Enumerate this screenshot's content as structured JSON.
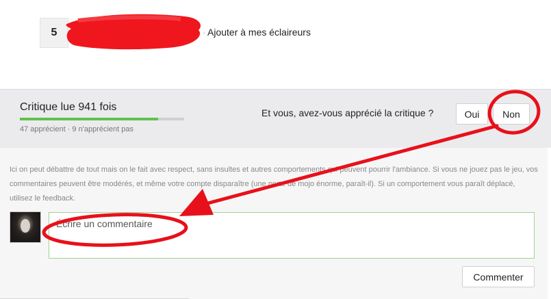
{
  "author_row": {
    "score": "5",
    "add_scouts_label": "Ajouter à mes éclaireurs"
  },
  "read_section": {
    "title": "Critique lue 941 fois",
    "appreciation_ratio": 0.84,
    "counts": "47 apprécient · 9 n'apprécient pas",
    "question": "Et vous, avez-vous apprécié la critique ?",
    "yes_label": "Oui",
    "no_label": "Non"
  },
  "comments": {
    "rules_text": "Ici on peut débattre de tout mais on le fait avec respect, sans insultes et autres comportements qui peuvent pourrir l'ambiance. Si vous ne jouez pas le jeu, vos commentaires peuvent être modérés, et même votre compte disparaître (une perte de mojo énorme, paraît-il). Si un comportement vous paraît déplacé, utilisez le feedback.",
    "input_placeholder": "Écrire un commentaire",
    "input_value": "",
    "submit_label": "Commenter"
  },
  "colors": {
    "progress": "#5ec24a",
    "annotation": "#e8101a",
    "input_border": "#9fd18f"
  }
}
